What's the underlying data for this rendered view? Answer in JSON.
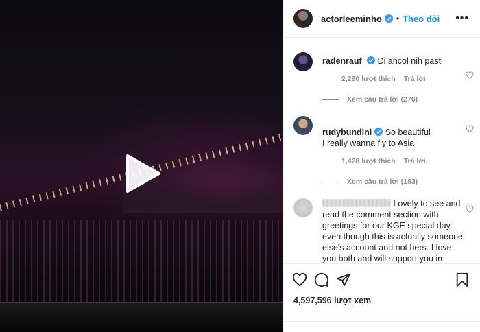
{
  "post": {
    "author": "actorleeminho",
    "follow_label": "Theo dõi",
    "separator": "•",
    "more_icon": "more-horizontal-icon"
  },
  "comments": [
    {
      "user": "radenrauf",
      "verified": true,
      "text": "Di ancol nih pasti",
      "likes": "2,290 lượt thích",
      "reply_label": "Trả lời",
      "view_replies": "Xem câu trả lời (276)"
    },
    {
      "user": "rudybundini",
      "verified": true,
      "text": "So beautiful\nI really wanna fly to Asia",
      "likes": "1,428 lượt thích",
      "reply_label": "Trả lời",
      "view_replies": "Xem câu trả lời (183)"
    },
    {
      "user": "",
      "verified": false,
      "text": "Lovely to see and read the comment section with greetings for our KGE special day even though this is actually someone else's account and not hers. I love you both and will support you in whatever may"
    }
  ],
  "footer": {
    "views": "4,597,596 lượt xem",
    "icons": [
      "heart-icon",
      "comment-icon",
      "share-icon",
      "bookmark-icon"
    ]
  },
  "colors": {
    "accent": "#0095f6",
    "muted": "#8e8e8e",
    "text": "#262626"
  }
}
